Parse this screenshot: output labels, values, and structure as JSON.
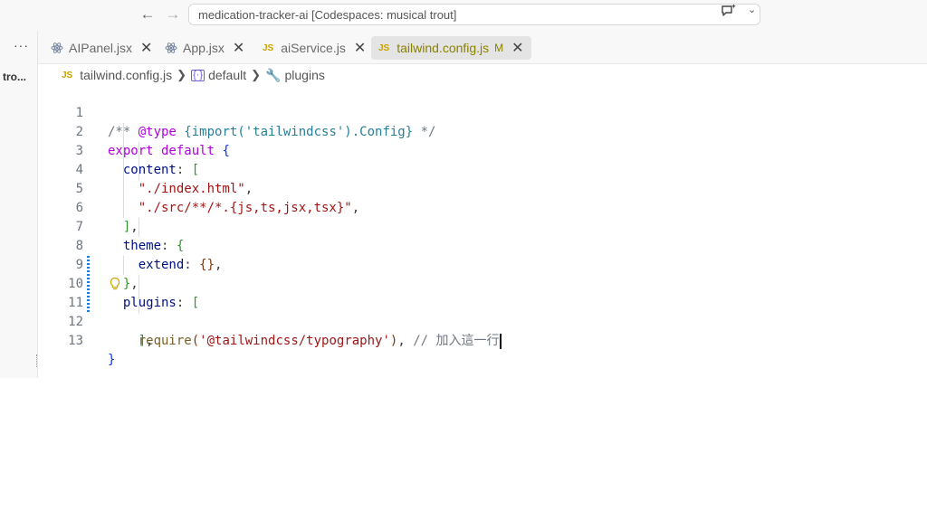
{
  "window": {
    "command_center_text": "medication-tracker-ai [Codespaces: musical trout]"
  },
  "sidebar": {
    "more_label": "···",
    "title": "tro..."
  },
  "tabs": [
    {
      "label": "AIPanel.jsx",
      "icon": "react-icon"
    },
    {
      "label": "App.jsx",
      "icon": "react-icon"
    },
    {
      "label": "aiService.js",
      "icon": "js-icon",
      "badge": "JS"
    },
    {
      "label": "tailwind.config.js",
      "icon": "js-icon",
      "badge": "JS",
      "modified": "M",
      "active": true
    }
  ],
  "breadcrumb": {
    "file_badge": "JS",
    "file": "tailwind.config.js",
    "symbol_icon": "symbol-variable-icon",
    "symbol": "default",
    "method_icon": "wrench-icon",
    "method": "plugins"
  },
  "editor": {
    "lines": [
      {
        "n": "1"
      },
      {
        "n": "2"
      },
      {
        "n": "3"
      },
      {
        "n": "4"
      },
      {
        "n": "5"
      },
      {
        "n": "6"
      },
      {
        "n": "7"
      },
      {
        "n": "8"
      },
      {
        "n": "9"
      },
      {
        "n": "10"
      },
      {
        "n": "11"
      },
      {
        "n": "12"
      },
      {
        "n": "13"
      }
    ],
    "code": {
      "l1_open": "/** ",
      "l1_tag": "@type",
      "l1_type": " {import('tailwindcss').Config}",
      "l1_close": " */",
      "l2_export": "export",
      "l2_default": " default ",
      "l2_brace": "{",
      "l3_key": "content",
      "l3_colon": ": ",
      "l3_bracket": "[",
      "l4_str": "\"./index.html\"",
      "l4_comma": ",",
      "l5_str": "\"./src/**/*.{js,ts,jsx,tsx}\"",
      "l5_comma": ",",
      "l6_bracket": "]",
      "l6_comma": ",",
      "l7_key": "theme",
      "l7_colon": ": ",
      "l7_brace": "{",
      "l8_key": "extend",
      "l8_colon": ": ",
      "l8_braces": "{}",
      "l8_comma": ",",
      "l9_brace": "}",
      "l9_comma": ",",
      "l10_key": "plugins",
      "l10_colon": ": ",
      "l10_bracket": "[",
      "l11_fn": "require",
      "l11_paren_open": "(",
      "l11_str": "'@tailwindcss/typography'",
      "l11_paren_close": ")",
      "l11_comma": ", ",
      "l11_comment": "// 加入這一行",
      "l12_bracket": "]",
      "l12_comma": ",",
      "l13_brace": "}"
    }
  }
}
